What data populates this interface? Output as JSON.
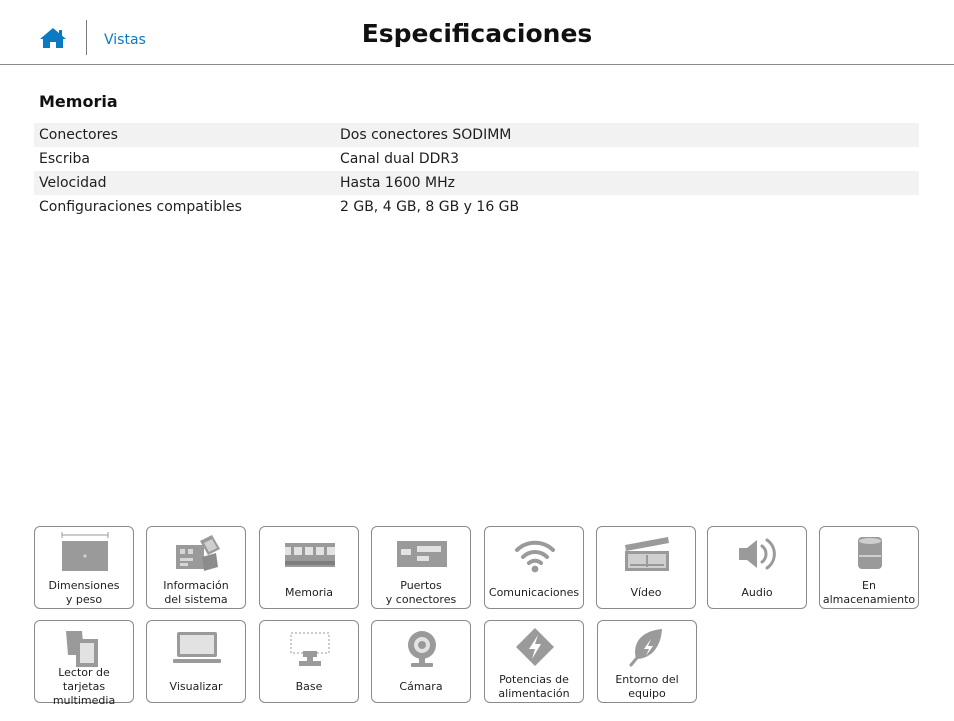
{
  "header": {
    "home_icon": "home-icon",
    "breadcrumb": "Vistas",
    "title": "Especificaciones",
    "accent_color": "#0b7ac2"
  },
  "section": {
    "title": "Memoria",
    "rows": [
      {
        "label": "Conectores",
        "value": "Dos conectores SODIMM"
      },
      {
        "label": "Escriba",
        "value": "Canal dual DDR3"
      },
      {
        "label": "Velocidad",
        "value": "Hasta 1600 MHz"
      },
      {
        "label": "Configuraciones compatibles",
        "value": "2 GB, 4 GB, 8 GB y 16 GB"
      }
    ]
  },
  "tiles": [
    {
      "label": "Dimensiones\ny peso",
      "icon": "laptop-dimensions-icon"
    },
    {
      "label": "Información\ndel sistema",
      "icon": "motherboard-icon"
    },
    {
      "label": "Memoria",
      "icon": "memory-module-icon"
    },
    {
      "label": "Puertos\ny conectores",
      "icon": "ports-icon"
    },
    {
      "label": "Comunicaciones",
      "icon": "wifi-icon"
    },
    {
      "label": "Vídeo",
      "icon": "video-clapperboard-icon"
    },
    {
      "label": "Audio",
      "icon": "speaker-icon"
    },
    {
      "label": "En\nalmacenamiento",
      "icon": "storage-drive-icon"
    },
    {
      "label": "Lector de tarjetas\nmultimedia",
      "icon": "media-card-icon"
    },
    {
      "label": "Visualizar",
      "icon": "display-icon"
    },
    {
      "label": "Base",
      "icon": "keyboard-base-icon"
    },
    {
      "label": "Cámara",
      "icon": "webcam-icon"
    },
    {
      "label": "Potencias de\nalimentación",
      "icon": "power-icon"
    },
    {
      "label": "Entorno del\nequipo",
      "icon": "environment-leaf-icon"
    }
  ]
}
